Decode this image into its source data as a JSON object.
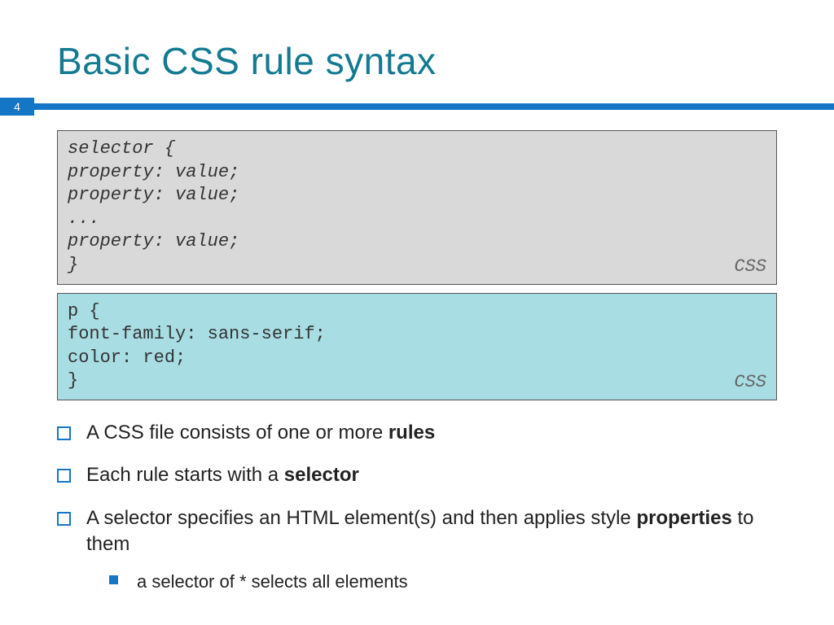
{
  "page_number": "4",
  "title": "Basic CSS rule syntax",
  "codebox1": {
    "content": "selector {\nproperty: value;\nproperty: value;\n...\nproperty: value;\n}",
    "label": "CSS"
  },
  "codebox2": {
    "content": "p {\nfont-family: sans-serif;\ncolor: red;\n}",
    "label": "CSS"
  },
  "bullets": [
    {
      "pre": "A CSS file consists of one or more ",
      "bold": "rules",
      "post": ""
    },
    {
      "pre": "Each rule starts with a ",
      "bold": "selector",
      "post": ""
    },
    {
      "pre": "A selector specifies an HTML element(s) and then applies style ",
      "bold": "properties",
      "post": " to them"
    }
  ],
  "subbullet": "a selector of * selects all elements"
}
